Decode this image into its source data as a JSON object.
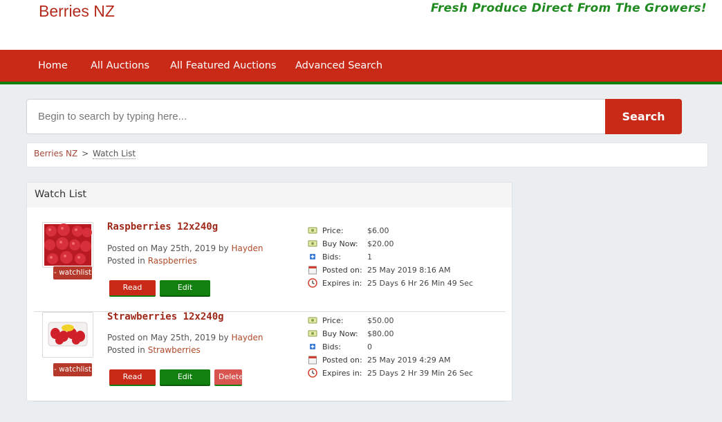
{
  "header": {
    "site_title": "Berries NZ",
    "tagline": "Fresh Produce Direct From The Growers!"
  },
  "nav": {
    "items": [
      "Home",
      "All Auctions",
      "All Featured Auctions",
      "Advanced Search"
    ]
  },
  "search": {
    "placeholder": "Begin to search by typing here...",
    "button_label": "Search"
  },
  "breadcrumb": {
    "home": "Berries NZ",
    "separator": ">",
    "current": "Watch List"
  },
  "panel": {
    "title": "Watch List"
  },
  "labels": {
    "price": "Price:",
    "buy_now": "Buy Now:",
    "bids": "Bids:",
    "posted_on": "Posted on:",
    "expires_in": "Expires in:",
    "posted_on_prefix": "Posted on",
    "by": "by",
    "posted_in": "Posted in",
    "watchlist_btn": "- watchlist",
    "read_more": "Read More",
    "edit_auction": "Edit Auction",
    "delete": "Delete"
  },
  "items": [
    {
      "title": "Raspberries 12x240g",
      "date": "May 25th, 2019",
      "author": "Hayden",
      "category": "Raspberries",
      "price": "$6.00",
      "buy_now": "$20.00",
      "bids": "1",
      "posted_on": "25 May 2019 8:16 AM",
      "expires_in": "25 Days 6 Hr 26 Min 49 Sec",
      "image": "raspberries-thumbnail"
    },
    {
      "title": "Strawberries 12x240g",
      "date": "May 25th, 2019",
      "author": "Hayden",
      "category": "Strawberries",
      "price": "$50.00",
      "buy_now": "$80.00",
      "bids": "0",
      "posted_on": "25 May 2019 4:29 AM",
      "expires_in": "25 Days 2 Hr 39 Min 26 Sec",
      "image": "strawberries-thumbnail"
    }
  ],
  "colors": {
    "brand_red": "#c92a18",
    "brand_green": "#11800f",
    "tagline_green": "#1f8a1f"
  }
}
